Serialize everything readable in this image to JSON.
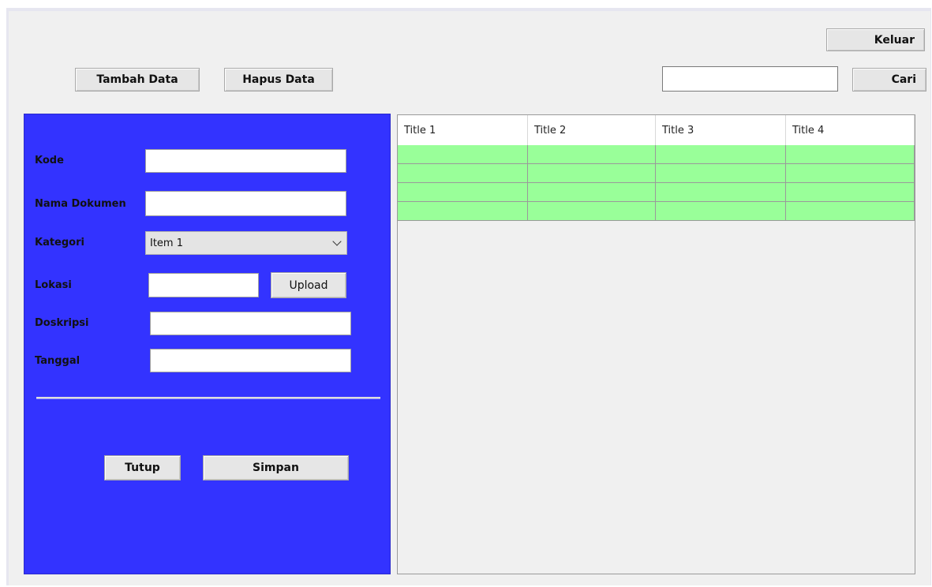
{
  "toolbar": {
    "add_label": "Tambah Data",
    "delete_label": "Hapus Data",
    "exit_label": "Keluar",
    "search_value": "",
    "search_label": "Cari"
  },
  "form": {
    "kode_label": "Kode",
    "kode_value": "",
    "nama_label": "Nama Dokumen",
    "nama_value": "",
    "kategori_label": "Kategori",
    "kategori_selected": "Item 1",
    "lokasi_label": "Lokasi",
    "lokasi_value": "",
    "upload_label": "Upload",
    "deskripsi_label": "Doskripsi",
    "deskripsi_value": "",
    "tanggal_label": "Tanggal",
    "tanggal_value": "",
    "close_label": "Tutup",
    "save_label": "Simpan"
  },
  "table": {
    "columns": [
      "Title 1",
      "Title 2",
      "Title 3",
      "Title 4"
    ],
    "rows": [
      [
        "",
        "",
        "",
        ""
      ],
      [
        "",
        "",
        "",
        ""
      ],
      [
        "",
        "",
        "",
        ""
      ],
      [
        "",
        "",
        "",
        ""
      ]
    ]
  },
  "colors": {
    "form_panel": "#3333ff",
    "row_fill": "#99ff99",
    "window_bg": "#f0f0f0"
  }
}
